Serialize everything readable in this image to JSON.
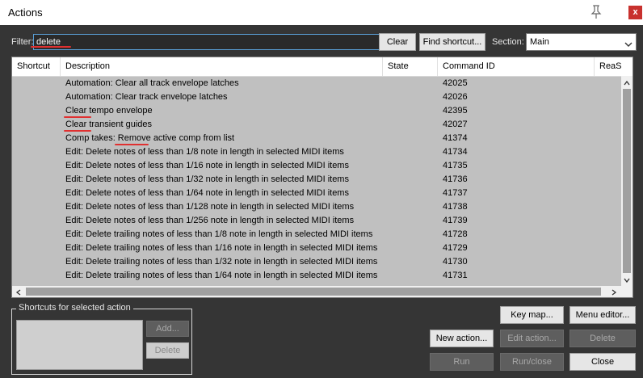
{
  "window": {
    "title": "Actions",
    "close_label": "x"
  },
  "filter": {
    "label": "Filter:",
    "value": "delete"
  },
  "toolbar": {
    "clear_label": "Clear",
    "find_shortcut_label": "Find shortcut..."
  },
  "section": {
    "label": "Section:",
    "selected": "Main"
  },
  "columns": [
    "Shortcut",
    "Description",
    "State",
    "Command ID",
    "ReaS"
  ],
  "rows": [
    {
      "description": "Automation: Clear all track envelope latches",
      "command_id": "42025"
    },
    {
      "description": "Automation: Clear track envelope latches",
      "command_id": "42026"
    },
    {
      "description": "Clear tempo envelope",
      "command_id": "42395"
    },
    {
      "description": "Clear transient guides",
      "command_id": "42027"
    },
    {
      "description": "Comp takes: Remove active comp from list",
      "command_id": "41374"
    },
    {
      "description": "Edit: Delete notes of less than 1/8 note in length in selected MIDI items",
      "command_id": "41734"
    },
    {
      "description": "Edit: Delete notes of less than 1/16 note in length in selected MIDI items",
      "command_id": "41735"
    },
    {
      "description": "Edit: Delete notes of less than 1/32 note in length in selected MIDI items",
      "command_id": "41736"
    },
    {
      "description": "Edit: Delete notes of less than 1/64 note in length in selected MIDI items",
      "command_id": "41737"
    },
    {
      "description": "Edit: Delete notes of less than 1/128 note in length in selected MIDI items",
      "command_id": "41738"
    },
    {
      "description": "Edit: Delete notes of less than 1/256 note in length in selected MIDI items",
      "command_id": "41739"
    },
    {
      "description": "Edit: Delete trailing notes of less than 1/8 note in length in selected MIDI items",
      "command_id": "41728"
    },
    {
      "description": "Edit: Delete trailing notes of less than 1/16 note in length in selected MIDI items",
      "command_id": "41729"
    },
    {
      "description": "Edit: Delete trailing notes of less than 1/32 note in length in selected MIDI items",
      "command_id": "41730"
    },
    {
      "description": "Edit: Delete trailing notes of less than 1/64 note in length in selected MIDI items",
      "command_id": "41731"
    }
  ],
  "shortcuts_group": {
    "label": "Shortcuts for selected action",
    "add_label": "Add...",
    "delete_label": "Delete"
  },
  "buttons": {
    "key_map": "Key map...",
    "menu_editor": "Menu editor...",
    "new_action": "New action...",
    "edit_action": "Edit action...",
    "delete": "Delete",
    "run": "Run",
    "run_close": "Run/close",
    "close": "Close"
  },
  "colors": {
    "annotation_red": "#e03030",
    "focus_blue": "#5aa0d8",
    "close_red": "#c8312e"
  }
}
